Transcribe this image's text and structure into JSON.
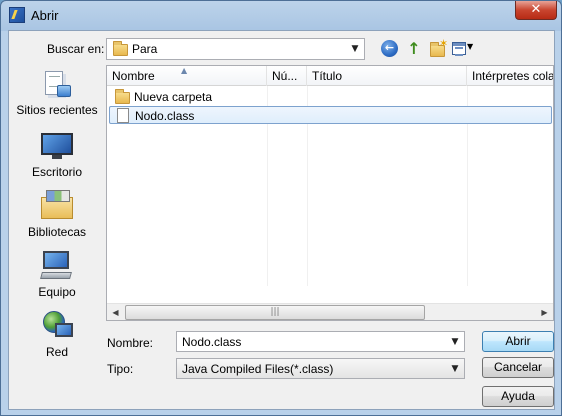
{
  "window": {
    "title": "Abrir",
    "close_glyph": "✕"
  },
  "toolbar": {
    "look_in_label": "Buscar en:",
    "look_in_value": "Para",
    "back_icon": "back-icon",
    "up_icon": "up-folder-icon",
    "new_folder_icon": "new-folder-icon",
    "views_icon": "views-menu-icon"
  },
  "places": [
    {
      "label": "Sitios recientes",
      "icon": "recent-places-icon"
    },
    {
      "label": "Escritorio",
      "icon": "desktop-icon"
    },
    {
      "label": "Bibliotecas",
      "icon": "libraries-icon"
    },
    {
      "label": "Equipo",
      "icon": "computer-icon"
    },
    {
      "label": "Red",
      "icon": "network-icon"
    }
  ],
  "filelist": {
    "columns": [
      "Nombre",
      "Nú...",
      "Título",
      "Intérpretes colab"
    ],
    "rows": [
      {
        "name": "Nueva carpeta",
        "type": "folder",
        "selected": false
      },
      {
        "name": "Nodo.class",
        "type": "file",
        "selected": true
      }
    ]
  },
  "form": {
    "name_label": "Nombre:",
    "name_value": "Nodo.class",
    "type_label": "Tipo:",
    "type_value": "Java Compiled Files(*.class)"
  },
  "buttons": {
    "open": "Abrir",
    "cancel": "Cancelar",
    "help": "Ayuda"
  },
  "colors": {
    "titlebar": "#b9d1ea",
    "close": "#c9452f",
    "selection": "#dfeefc"
  }
}
